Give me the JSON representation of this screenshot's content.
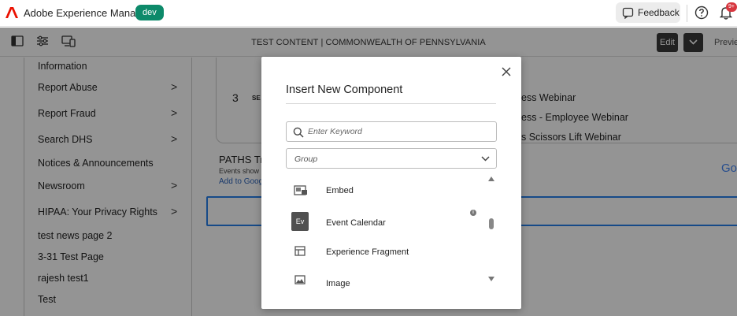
{
  "shell": {
    "app_name": "Adobe Experience Manager",
    "env_badge": "dev",
    "feedback_label": "Feedback",
    "notification_count": "9+"
  },
  "toolbar": {
    "page_title": "TEST CONTENT | COMMONWEALTH OF PENNSYLVANIA",
    "edit_label": "Edit",
    "preview_label": "Previe"
  },
  "nav": {
    "cut_top": "Information",
    "items": [
      {
        "label": "Report Abuse",
        "chevron": ">"
      },
      {
        "label": "Report Fraud",
        "chevron": ">"
      },
      {
        "label": "Search DHS",
        "chevron": ">"
      },
      {
        "label": "Notices & Announcements",
        "chevron": ""
      },
      {
        "label": "Newsroom",
        "chevron": ">"
      },
      {
        "label": "HIPAA: Your Privacy Rights",
        "chevron": ">"
      },
      {
        "label": "test news page 2",
        "chevron": ""
      },
      {
        "label": "3-31 Test Page",
        "chevron": ""
      },
      {
        "label": "rajesh test1",
        "chevron": ""
      },
      {
        "label": "Test",
        "chevron": ""
      }
    ]
  },
  "content": {
    "row_number": "3",
    "row_prefix": "SE",
    "events": [
      "ess Webinar",
      "ess - Employee Webinar",
      "s Scissors Lift Webinar"
    ],
    "paths_title": "PATHS Tr",
    "events_sub": "Events show",
    "add_google": "Add to Goog",
    "google_fragment": "Go"
  },
  "modal": {
    "title": "Insert New Component",
    "search_placeholder": "Enter Keyword",
    "group_placeholder": "Group",
    "components": [
      {
        "label": "Embed",
        "icon": "embed-icon"
      },
      {
        "label": "Event Calendar",
        "icon": "event-calendar-icon",
        "abbr": "Ev"
      },
      {
        "label": "Experience Fragment",
        "icon": "experience-fragment-icon"
      },
      {
        "label": "Image",
        "icon": "image-icon"
      }
    ],
    "info_glyph": "i"
  }
}
